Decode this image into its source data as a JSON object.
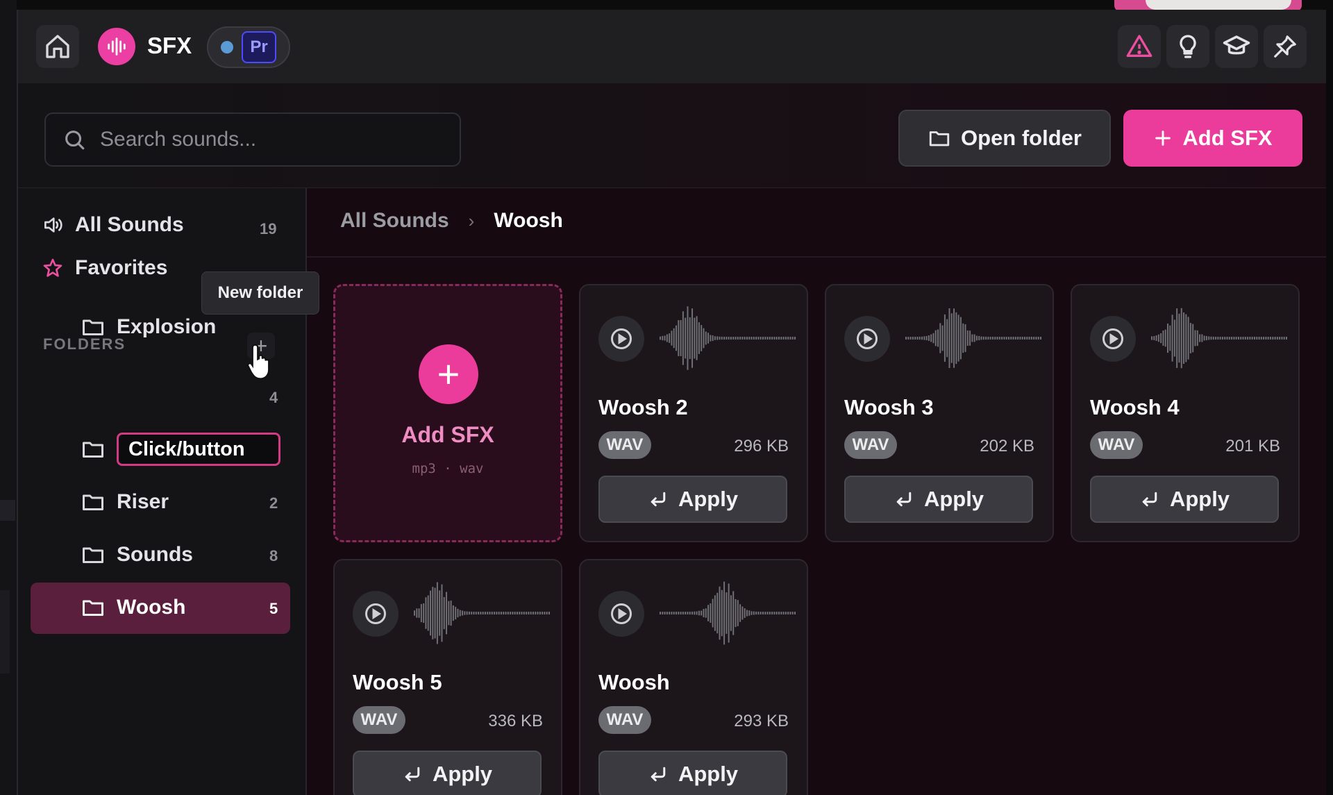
{
  "header": {
    "app_name": "SFX",
    "host_badge": "Pr",
    "icons": [
      "home-icon",
      "sfx-logo-icon",
      "warning-icon",
      "lightbulb-icon",
      "graduation-cap-icon",
      "pin-icon"
    ]
  },
  "toolbar": {
    "search_placeholder": "Search sounds...",
    "open_folder_label": "Open folder",
    "add_sfx_label": "Add SFX"
  },
  "sidebar": {
    "all_sounds": {
      "label": "All Sounds",
      "count": "19"
    },
    "favorites": {
      "label": "Favorites"
    },
    "tooltip": "New folder",
    "folders_title": "FOLDERS",
    "add_folder_symbol": "+",
    "rename_value": "Click/button",
    "folders": [
      {
        "label": "Explosion",
        "count": "4"
      },
      {
        "label": "Riser",
        "count": "2"
      },
      {
        "label": "Sounds",
        "count": "8"
      },
      {
        "label": "Woosh",
        "count": "5"
      }
    ]
  },
  "breadcrumb": {
    "root": "All Sounds",
    "separator": "›",
    "current": "Woosh"
  },
  "add_card": {
    "symbol": "+",
    "title": "Add SFX",
    "formats": "mp3 · wav"
  },
  "sounds": [
    {
      "name": "Woosh 2",
      "format": "WAV",
      "size": "296 KB",
      "apply": "Apply"
    },
    {
      "name": "Woosh 3",
      "format": "WAV",
      "size": "202 KB",
      "apply": "Apply"
    },
    {
      "name": "Woosh 4",
      "format": "WAV",
      "size": "201 KB",
      "apply": "Apply"
    },
    {
      "name": "Woosh 5",
      "format": "WAV",
      "size": "336 KB",
      "apply": "Apply"
    },
    {
      "name": "Woosh",
      "format": "WAV",
      "size": "293 KB",
      "apply": "Apply"
    }
  ],
  "colors": {
    "accent": "#ec3c9b",
    "active_folder_bg": "#5a1f3d",
    "background": "#16090f",
    "host_dot": "#5b9bd5"
  }
}
